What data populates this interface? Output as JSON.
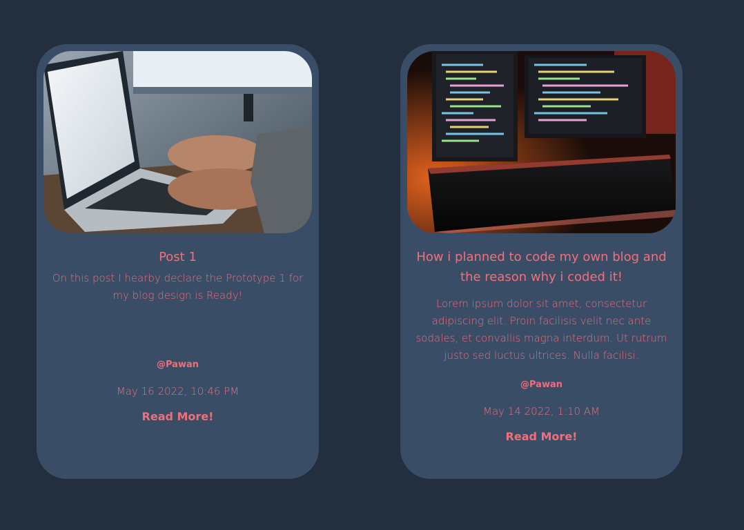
{
  "colors": {
    "background": "#232f3f",
    "card": "#394d67",
    "accent": "#f2707a"
  },
  "posts": [
    {
      "image_icon": "laptop-typing-photo",
      "title": "Post 1",
      "excerpt": "On this post I hearby declare the Prototype 1 for my blog design is Ready!",
      "author": "@Pawan",
      "date": "May 16 2022, 10:46 PM",
      "read_more": "Read More!"
    },
    {
      "image_icon": "code-monitors-keyboard-photo",
      "title": "How i planned to code my own blog and the reason why i coded it!",
      "excerpt": "Lorem ipsum dolor sit amet, consectetur adipiscing elit. Proin facilisis velit nec ante sodales, et convallis magna interdum. Ut rutrum justo sed luctus ultrices. Nulla facilisi.",
      "author": "@Pawan",
      "date": "May 14 2022, 1:10 AM",
      "read_more": "Read More!"
    }
  ]
}
